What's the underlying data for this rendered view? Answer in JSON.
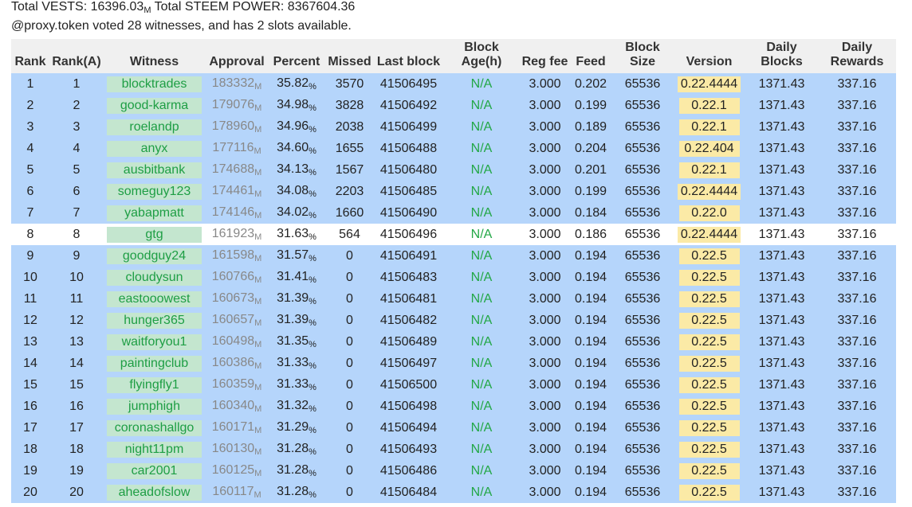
{
  "summary": {
    "vests_label": "Total VESTS: 16396.03",
    "vests_unit": "M",
    "sp_label": " Total STEEM POWER: 8367604.36",
    "proxy_line": "@proxy.token voted 28 witnesses, and has 2 slots available."
  },
  "columns": [
    "Rank",
    "Rank(A)",
    "Witness",
    "Approval",
    "Percent",
    "Missed",
    "Last block",
    "Block Age(h)",
    "Reg fee",
    "Feed",
    "Block Size",
    "Version",
    "Daily Blocks",
    "Daily Rewards"
  ],
  "units": {
    "approval": "M",
    "percent": "%"
  },
  "colors": {
    "active_row": "#b5d5fb",
    "inactive_row": "#ffffff",
    "witness_bg": "#c4e6cf",
    "witness_text": "#1e9e44",
    "version_bg": "#fbeaa6",
    "na_text": "#22a745"
  },
  "rows": [
    {
      "rank": "1",
      "ranka": "1",
      "witness": "blocktrades",
      "approval": "183332",
      "percent": "35.82",
      "missed": "3570",
      "last_block": "41506495",
      "age": "N/A",
      "reg_fee": "3.000",
      "feed": "0.202",
      "block_size": "65536",
      "version": "0.22.4444",
      "daily_blocks": "1371.43",
      "daily_rewards": "337.16",
      "active": true
    },
    {
      "rank": "2",
      "ranka": "2",
      "witness": "good-karma",
      "approval": "179076",
      "percent": "34.98",
      "missed": "3828",
      "last_block": "41506492",
      "age": "N/A",
      "reg_fee": "3.000",
      "feed": "0.199",
      "block_size": "65536",
      "version": "0.22.1",
      "daily_blocks": "1371.43",
      "daily_rewards": "337.16",
      "active": true
    },
    {
      "rank": "3",
      "ranka": "3",
      "witness": "roelandp",
      "approval": "178960",
      "percent": "34.96",
      "missed": "2038",
      "last_block": "41506499",
      "age": "N/A",
      "reg_fee": "3.000",
      "feed": "0.189",
      "block_size": "65536",
      "version": "0.22.1",
      "daily_blocks": "1371.43",
      "daily_rewards": "337.16",
      "active": true
    },
    {
      "rank": "4",
      "ranka": "4",
      "witness": "anyx",
      "approval": "177116",
      "percent": "34.60",
      "missed": "1655",
      "last_block": "41506488",
      "age": "N/A",
      "reg_fee": "3.000",
      "feed": "0.204",
      "block_size": "65536",
      "version": "0.22.404",
      "daily_blocks": "1371.43",
      "daily_rewards": "337.16",
      "active": true
    },
    {
      "rank": "5",
      "ranka": "5",
      "witness": "ausbitbank",
      "approval": "174688",
      "percent": "34.13",
      "missed": "1567",
      "last_block": "41506480",
      "age": "N/A",
      "reg_fee": "3.000",
      "feed": "0.201",
      "block_size": "65536",
      "version": "0.22.1",
      "daily_blocks": "1371.43",
      "daily_rewards": "337.16",
      "active": true
    },
    {
      "rank": "6",
      "ranka": "6",
      "witness": "someguy123",
      "approval": "174461",
      "percent": "34.08",
      "missed": "2203",
      "last_block": "41506485",
      "age": "N/A",
      "reg_fee": "3.000",
      "feed": "0.199",
      "block_size": "65536",
      "version": "0.22.4444",
      "daily_blocks": "1371.43",
      "daily_rewards": "337.16",
      "active": true
    },
    {
      "rank": "7",
      "ranka": "7",
      "witness": "yabapmatt",
      "approval": "174146",
      "percent": "34.02",
      "missed": "1660",
      "last_block": "41506490",
      "age": "N/A",
      "reg_fee": "3.000",
      "feed": "0.184",
      "block_size": "65536",
      "version": "0.22.0",
      "daily_blocks": "1371.43",
      "daily_rewards": "337.16",
      "active": true
    },
    {
      "rank": "8",
      "ranka": "8",
      "witness": "gtg",
      "approval": "161923",
      "percent": "31.63",
      "missed": "564",
      "last_block": "41506496",
      "age": "N/A",
      "reg_fee": "3.000",
      "feed": "0.186",
      "block_size": "65536",
      "version": "0.22.4444",
      "daily_blocks": "1371.43",
      "daily_rewards": "337.16",
      "active": false
    },
    {
      "rank": "9",
      "ranka": "9",
      "witness": "goodguy24",
      "approval": "161598",
      "percent": "31.57",
      "missed": "0",
      "last_block": "41506491",
      "age": "N/A",
      "reg_fee": "3.000",
      "feed": "0.194",
      "block_size": "65536",
      "version": "0.22.5",
      "daily_blocks": "1371.43",
      "daily_rewards": "337.16",
      "active": true
    },
    {
      "rank": "10",
      "ranka": "10",
      "witness": "cloudysun",
      "approval": "160766",
      "percent": "31.41",
      "missed": "0",
      "last_block": "41506483",
      "age": "N/A",
      "reg_fee": "3.000",
      "feed": "0.194",
      "block_size": "65536",
      "version": "0.22.5",
      "daily_blocks": "1371.43",
      "daily_rewards": "337.16",
      "active": true
    },
    {
      "rank": "11",
      "ranka": "11",
      "witness": "eastooowest",
      "approval": "160673",
      "percent": "31.39",
      "missed": "0",
      "last_block": "41506481",
      "age": "N/A",
      "reg_fee": "3.000",
      "feed": "0.194",
      "block_size": "65536",
      "version": "0.22.5",
      "daily_blocks": "1371.43",
      "daily_rewards": "337.16",
      "active": true
    },
    {
      "rank": "12",
      "ranka": "12",
      "witness": "hunger365",
      "approval": "160657",
      "percent": "31.39",
      "missed": "0",
      "last_block": "41506482",
      "age": "N/A",
      "reg_fee": "3.000",
      "feed": "0.194",
      "block_size": "65536",
      "version": "0.22.5",
      "daily_blocks": "1371.43",
      "daily_rewards": "337.16",
      "active": true
    },
    {
      "rank": "13",
      "ranka": "13",
      "witness": "waitforyou1",
      "approval": "160498",
      "percent": "31.35",
      "missed": "0",
      "last_block": "41506489",
      "age": "N/A",
      "reg_fee": "3.000",
      "feed": "0.194",
      "block_size": "65536",
      "version": "0.22.5",
      "daily_blocks": "1371.43",
      "daily_rewards": "337.16",
      "active": true
    },
    {
      "rank": "14",
      "ranka": "14",
      "witness": "paintingclub",
      "approval": "160386",
      "percent": "31.33",
      "missed": "0",
      "last_block": "41506497",
      "age": "N/A",
      "reg_fee": "3.000",
      "feed": "0.194",
      "block_size": "65536",
      "version": "0.22.5",
      "daily_blocks": "1371.43",
      "daily_rewards": "337.16",
      "active": true
    },
    {
      "rank": "15",
      "ranka": "15",
      "witness": "flyingfly1",
      "approval": "160359",
      "percent": "31.33",
      "missed": "0",
      "last_block": "41506500",
      "age": "N/A",
      "reg_fee": "3.000",
      "feed": "0.194",
      "block_size": "65536",
      "version": "0.22.5",
      "daily_blocks": "1371.43",
      "daily_rewards": "337.16",
      "active": true
    },
    {
      "rank": "16",
      "ranka": "16",
      "witness": "jumphigh",
      "approval": "160340",
      "percent": "31.32",
      "missed": "0",
      "last_block": "41506498",
      "age": "N/A",
      "reg_fee": "3.000",
      "feed": "0.194",
      "block_size": "65536",
      "version": "0.22.5",
      "daily_blocks": "1371.43",
      "daily_rewards": "337.16",
      "active": true
    },
    {
      "rank": "17",
      "ranka": "17",
      "witness": "coronashallgo",
      "approval": "160171",
      "percent": "31.29",
      "missed": "0",
      "last_block": "41506494",
      "age": "N/A",
      "reg_fee": "3.000",
      "feed": "0.194",
      "block_size": "65536",
      "version": "0.22.5",
      "daily_blocks": "1371.43",
      "daily_rewards": "337.16",
      "active": true
    },
    {
      "rank": "18",
      "ranka": "18",
      "witness": "night11pm",
      "approval": "160130",
      "percent": "31.28",
      "missed": "0",
      "last_block": "41506493",
      "age": "N/A",
      "reg_fee": "3.000",
      "feed": "0.194",
      "block_size": "65536",
      "version": "0.22.5",
      "daily_blocks": "1371.43",
      "daily_rewards": "337.16",
      "active": true
    },
    {
      "rank": "19",
      "ranka": "19",
      "witness": "car2001",
      "approval": "160125",
      "percent": "31.28",
      "missed": "0",
      "last_block": "41506486",
      "age": "N/A",
      "reg_fee": "3.000",
      "feed": "0.194",
      "block_size": "65536",
      "version": "0.22.5",
      "daily_blocks": "1371.43",
      "daily_rewards": "337.16",
      "active": true
    },
    {
      "rank": "20",
      "ranka": "20",
      "witness": "aheadofslow",
      "approval": "160117",
      "percent": "31.28",
      "missed": "0",
      "last_block": "41506484",
      "age": "N/A",
      "reg_fee": "3.000",
      "feed": "0.194",
      "block_size": "65536",
      "version": "0.22.5",
      "daily_blocks": "1371.43",
      "daily_rewards": "337.16",
      "active": true
    }
  ]
}
